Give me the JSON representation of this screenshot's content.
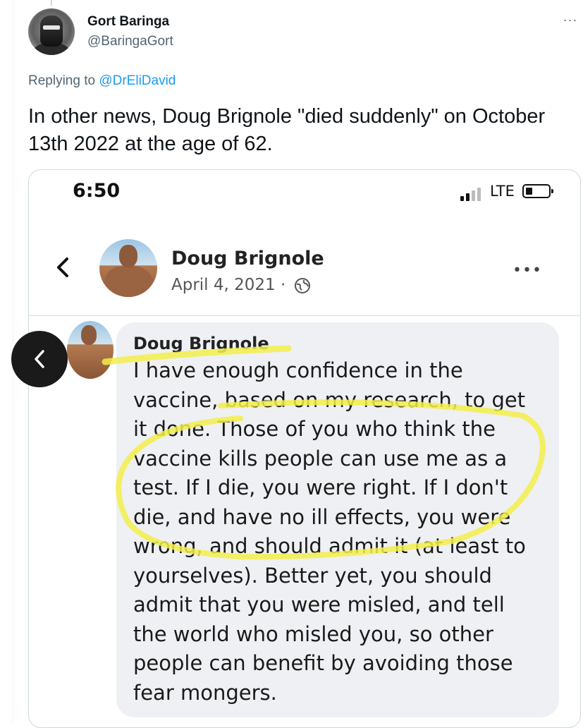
{
  "tweet": {
    "author_name": "Gort Baringa",
    "author_handle": "@BaringaGort",
    "more_label": "···",
    "replying_prefix": "Replying to ",
    "replying_to": "@DrEliDavid",
    "text": "In other news, Doug Brignole \"died suddenly\" on October 13th 2022 at the age of 62."
  },
  "screenshot": {
    "status_time": "6:50",
    "network": "LTE",
    "post": {
      "author": "Doug Brignole",
      "date": "April 4, 2021 ·",
      "more_label": "•••"
    },
    "comment": {
      "author": "Doug Brignole",
      "body": "I have enough confidence in the\nvaccine, based on my research, to get\nit done. Those of you who think the\nvaccine kills people can use me as a\ntest. If I die, you were right. If I don't\ndie, and have no ill effects, you were\nwrong, and should admit it (at least to\nyourselves). Better yet, you should\nadmit that you were misled, and tell\nthe world who misled you, so other\npeople can benefit by avoiding those\nfear mongers."
    },
    "highlight_color": "#f3ee4a"
  },
  "icons": {
    "avatar": "robot-helmet-avatar",
    "back": "chevron-left-icon",
    "globe": "globe-icon",
    "carousel_prev": "chevron-left-icon"
  }
}
